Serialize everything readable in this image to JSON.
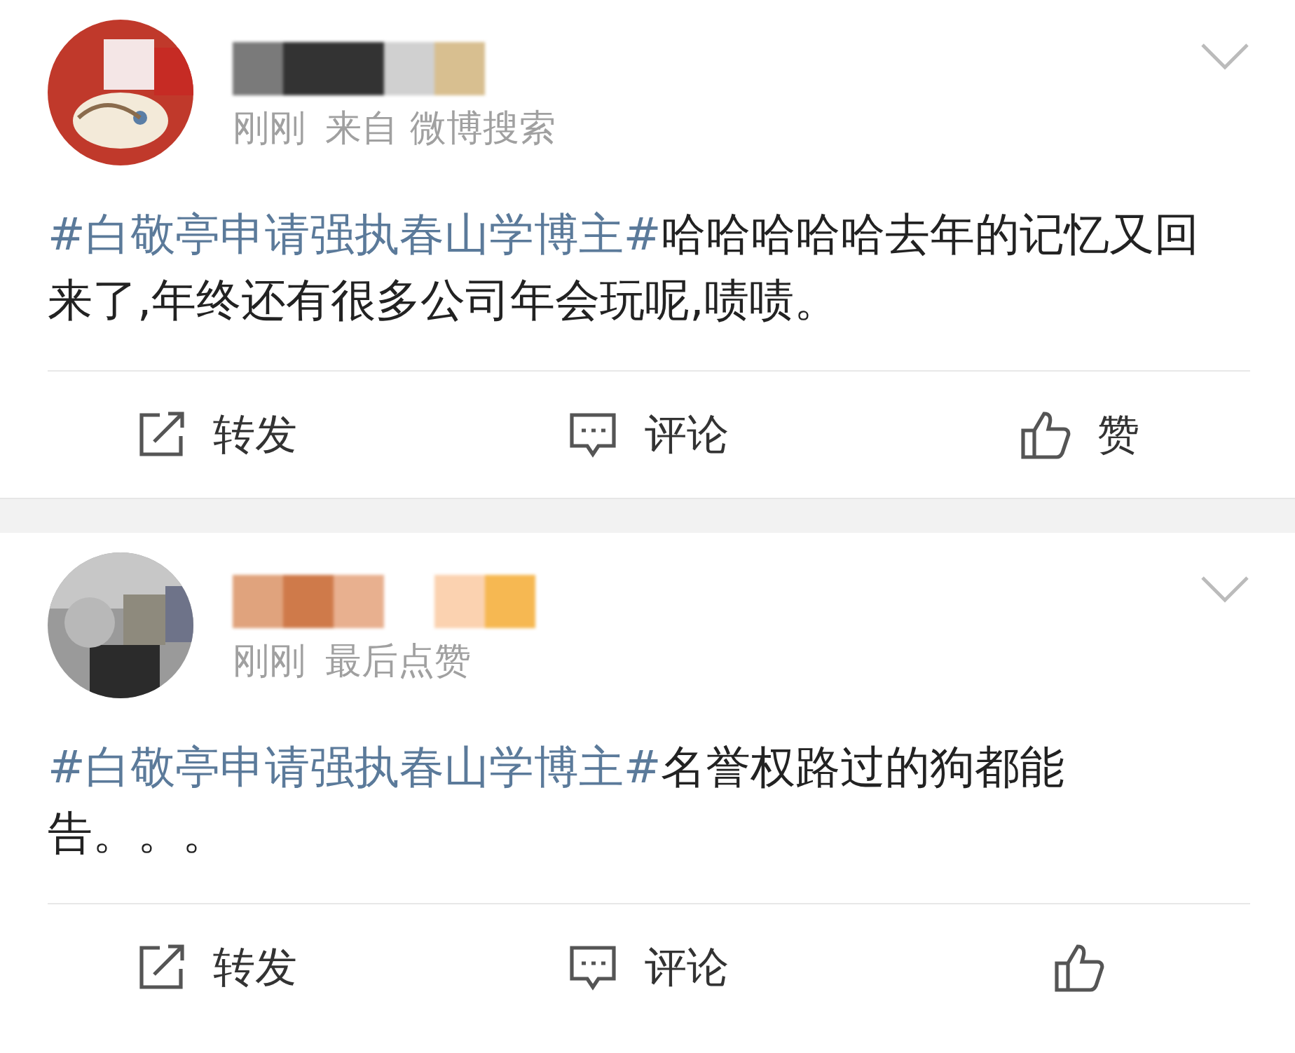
{
  "posts": [
    {
      "avatar": {
        "kind": "picture"
      },
      "time": "刚刚",
      "source": "来自 微博搜索",
      "body": [
        {
          "kind": "topic",
          "text": "#白敬亭申请强执春山学博主#"
        },
        {
          "kind": "plain",
          "text": "哈哈哈哈哈去年的记忆又回来了,年终还有很多公司年会玩呢,啧啧。"
        }
      ],
      "actions": [
        {
          "kind": "repost",
          "label": "转发"
        },
        {
          "kind": "comment",
          "label": "评论"
        },
        {
          "kind": "like",
          "label": "赞"
        }
      ]
    },
    {
      "avatar": {
        "kind": "picture"
      },
      "time": "刚刚",
      "source": "最后点赞",
      "body": [
        {
          "kind": "topic",
          "text": "#白敬亭申请强执春山学博主#"
        },
        {
          "kind": "plain",
          "text": "名誉权路过的狗都能告。。。"
        }
      ],
      "actions": [
        {
          "kind": "repost",
          "label": "转发"
        },
        {
          "kind": "comment",
          "label": "评论"
        },
        {
          "kind": "like"
        }
      ]
    }
  ]
}
